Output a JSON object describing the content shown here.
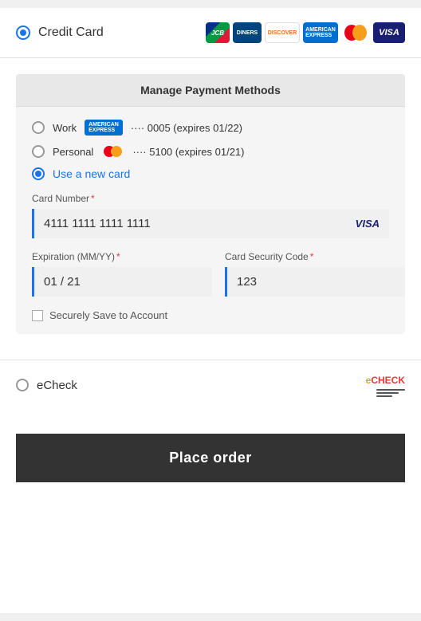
{
  "header": {
    "title": "Credit Card",
    "logos": [
      "JCB",
      "Diners Club",
      "Discover",
      "American Express",
      "Mastercard",
      "VISA"
    ]
  },
  "manage_payment": {
    "title": "Manage Payment Methods",
    "saved_cards": [
      {
        "label": "Work",
        "brand": "amex",
        "last4": "0005",
        "expires": "01/22",
        "text": "···· 0005 (expires 01/22)"
      },
      {
        "label": "Personal",
        "brand": "mastercard",
        "last4": "5100",
        "expires": "01/21",
        "text": "···· 5100 (expires 01/21)"
      }
    ],
    "new_card_label": "Use a new card",
    "fields": {
      "card_number": {
        "label": "Card Number",
        "required": true,
        "value": "4111 1111 1111 1111",
        "card_type": "VISA"
      },
      "expiration": {
        "label": "Expiration (MM/YY)",
        "required": true,
        "value": "01 / 21"
      },
      "security_code": {
        "label": "Card Security Code",
        "required": true,
        "value": "123"
      }
    },
    "save_checkbox": {
      "label": "Securely Save to Account",
      "checked": false
    }
  },
  "echeck": {
    "label": "eCheck",
    "logo_text": "eCHECK"
  },
  "place_order": {
    "button_label": "Place order"
  }
}
